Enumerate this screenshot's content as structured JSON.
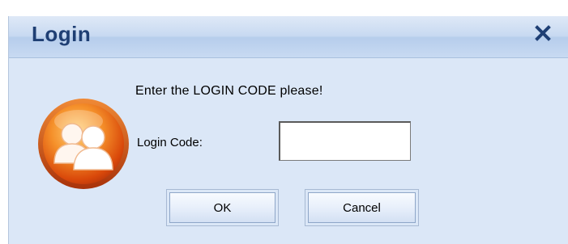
{
  "dialog": {
    "title": "Login",
    "close_icon": "close-icon",
    "prompt": "Enter the LOGIN CODE please!",
    "avatar_icon": "users-icon",
    "login_code_label": "Login Code:",
    "login_code_value": "",
    "ok_label": "OK",
    "cancel_label": "Cancel"
  },
  "colors": {
    "dialog_bg": "#dbe7f7",
    "title_text": "#1f3f74",
    "avatar_orange": "#e8650f"
  }
}
